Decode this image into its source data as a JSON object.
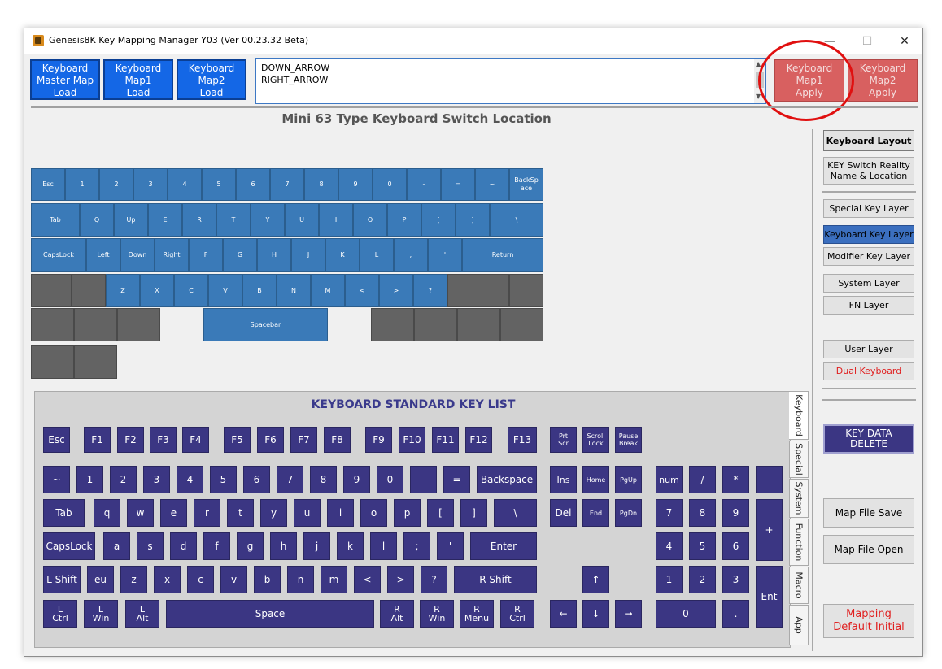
{
  "window": {
    "title": "Genesis8K Key Mapping Manager Y03 (Ver 00.23.32 Beta)"
  },
  "controls": {
    "minimize": "—",
    "maximize": "☐",
    "close": "✕"
  },
  "top_buttons": {
    "master_load": "Keyboard\nMaster Map\nLoad",
    "map1_load": "Keyboard\nMap1\nLoad",
    "map2_load": "Keyboard\nMap2\nLoad",
    "map1_apply": "Keyboard\nMap1\nApply",
    "map2_apply": "Keyboard\nMap2\nApply"
  },
  "key_info": {
    "text": "DOWN_ARROW\nRIGHT_ARROW"
  },
  "layout_title": "Mini 63 Type Keyboard Switch Location",
  "layout_keys": {
    "r1": [
      "Esc",
      "1",
      "2",
      "3",
      "4",
      "5",
      "6",
      "7",
      "8",
      "9",
      "0",
      "-",
      "=",
      "~",
      "BackSp\nace"
    ],
    "r2": [
      "Tab",
      "Q",
      "Up",
      "E",
      "R",
      "T",
      "Y",
      "U",
      "I",
      "O",
      "P",
      "[",
      "]",
      "\\"
    ],
    "r3": [
      "CapsLock",
      "Left",
      "Down",
      "Right",
      "F",
      "G",
      "H",
      "J",
      "K",
      "L",
      ";",
      "'",
      "Return"
    ],
    "r4": [
      "Z",
      "X",
      "C",
      "V",
      "B",
      "N",
      "M",
      "<",
      ">",
      "?"
    ],
    "r5": [
      "Spacebar"
    ]
  },
  "std_title": "KEYBOARD STANDARD KEY LIST",
  "std_keys": {
    "fn": [
      "Esc",
      "F1",
      "F2",
      "F3",
      "F4",
      "F5",
      "F6",
      "F7",
      "F8",
      "F9",
      "F10",
      "F11",
      "F12",
      "F13"
    ],
    "sys": [
      "Prt\nScr",
      "Scroll\nLock",
      "Pause\nBreak"
    ],
    "num_row": [
      "~",
      "1",
      "2",
      "3",
      "4",
      "5",
      "6",
      "7",
      "8",
      "9",
      "0",
      "-",
      "=",
      "Backspace"
    ],
    "tab_row": [
      "Tab",
      "q",
      "w",
      "e",
      "r",
      "t",
      "y",
      "u",
      "i",
      "o",
      "p",
      "[",
      "]",
      "\\"
    ],
    "caps_row": [
      "CapsLock",
      "a",
      "s",
      "d",
      "f",
      "g",
      "h",
      "j",
      "k",
      "l",
      ";",
      "'",
      "Enter"
    ],
    "shift_row": [
      "L Shift",
      "eu",
      "z",
      "x",
      "c",
      "v",
      "b",
      "n",
      "m",
      "<",
      ">",
      "?",
      "R Shift"
    ],
    "bottom_row": [
      "L\nCtrl",
      "L\nWin",
      "L\nAlt",
      "Space",
      "R\nAlt",
      "R\nWin",
      "R\nMenu",
      "R\nCtrl"
    ],
    "nav1": [
      "Ins",
      "Home",
      "PgUp"
    ],
    "nav2": [
      "Del",
      "End",
      "PgDn"
    ],
    "arrows": [
      "↑",
      "←",
      "↓",
      "→"
    ],
    "numpad": [
      "num",
      "/",
      "*",
      "-",
      "7",
      "8",
      "9",
      "+",
      "4",
      "5",
      "6",
      "1",
      "2",
      "3",
      "Ent",
      "0",
      "."
    ]
  },
  "tabs": [
    "Keyboard",
    "Special",
    "System",
    "Function",
    "Macro",
    "App"
  ],
  "right_buttons": {
    "keyboard_layout": "Keyboard Layout",
    "key_switch": "KEY Switch Reality\nName & Location",
    "special_layer": "Special Key Layer",
    "keyboard_layer": "Keyboard Key Layer",
    "modifier_layer": "Modifier Key Layer",
    "system_layer": "System Layer",
    "fn_layer": "FN Layer",
    "user_layer": "User Layer",
    "dual_keyboard": "Dual Keyboard",
    "key_data_delete": "KEY DATA\nDELETE",
    "map_save": "Map File Save",
    "map_open": "Map File Open",
    "mapping_default": "Mapping\nDefault Initial"
  },
  "colors": {
    "layout_key": "#3a7ab8",
    "unused_key": "#636363",
    "std_key": "#3b3683",
    "load_btn": "#1467e6",
    "apply_btn": "#d86060",
    "highlight": "#e01010"
  }
}
